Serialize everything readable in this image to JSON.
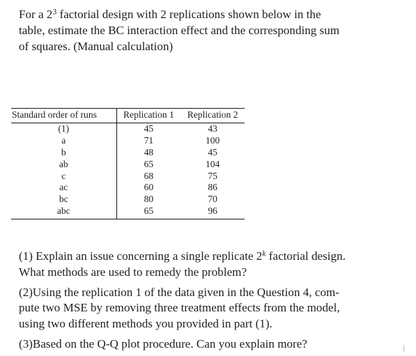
{
  "document": {
    "intro": {
      "line1_a": "For a 2",
      "line1_sup": "3",
      "line1_b": " factorial design with 2 replications shown below in the",
      "line2": "table, estimate the BC interaction effect and the corresponding sum",
      "line3": "of squares. (Manual calculation)"
    },
    "table": {
      "headers": [
        "Standard order of runs",
        "Replication 1",
        "Replication 2"
      ],
      "rows": [
        {
          "run": "(1)",
          "rep1": "45",
          "rep2": "43"
        },
        {
          "run": "a",
          "rep1": "71",
          "rep2": "100"
        },
        {
          "run": "b",
          "rep1": "48",
          "rep2": "45"
        },
        {
          "run": "ab",
          "rep1": "65",
          "rep2": "104"
        },
        {
          "run": "c",
          "rep1": "68",
          "rep2": "75"
        },
        {
          "run": "ac",
          "rep1": "60",
          "rep2": "86"
        },
        {
          "run": "bc",
          "rep1": "80",
          "rep2": "70"
        },
        {
          "run": "abc",
          "rep1": "65",
          "rep2": "96"
        }
      ]
    },
    "questions": {
      "q1": {
        "line1_a": "(1) Explain an issue concerning a single replicate 2",
        "line1_sup": "k",
        "line1_b": " factorial design.",
        "line2": "What methods are used to remedy the problem?"
      },
      "q2": {
        "line1": "(2)Using the replication 1 of the data given in the Question 4, com-",
        "line2": "pute two MSE by removing three treatment effects from the model,",
        "line3": "using two different methods you provided in part (1)."
      },
      "q3": {
        "line1": "(3)Based on the Q-Q plot procedure. Can you explain more?"
      }
    },
    "colors": {
      "background": "#ffffff",
      "text": "#1e1e2a",
      "rule": "#14141c"
    }
  }
}
